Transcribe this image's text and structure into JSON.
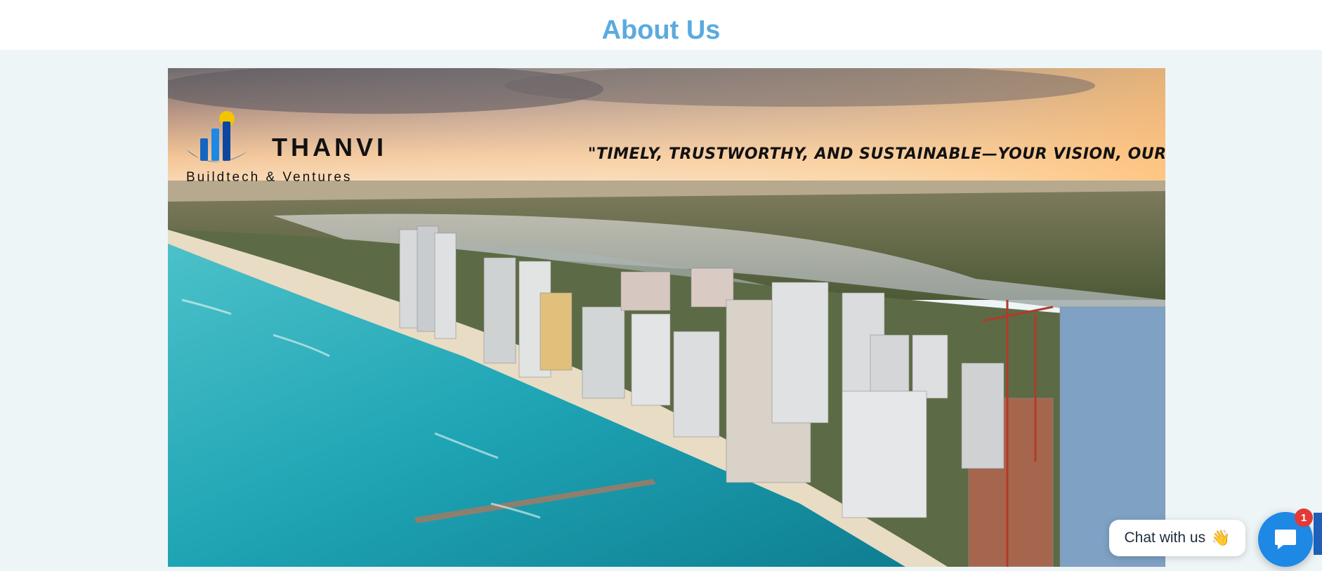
{
  "page": {
    "title": "About Us",
    "title_color": "#5aaae0",
    "section_background": "#eef5f7"
  },
  "banner": {
    "image_subject": "aerial photo of a coastal city skyline with beach, pier and turquoise sea at sunset",
    "logo": {
      "name": "THANVI",
      "subtitle": "Buildtech & Ventures",
      "icon": "rising-bars-logo-icon",
      "colors": {
        "bars": "#1565c0",
        "sun": "#f5c400"
      }
    },
    "tagline": "\"Timely, trustworthy, and sustainable—your vision, our foundation.\""
  },
  "chat": {
    "label": "Chat with us",
    "emoji": "👋",
    "badge_count": "1",
    "launcher_icon": "chat-bubble-icon",
    "launcher_color": "#1e88e5",
    "badge_color": "#e53935"
  }
}
